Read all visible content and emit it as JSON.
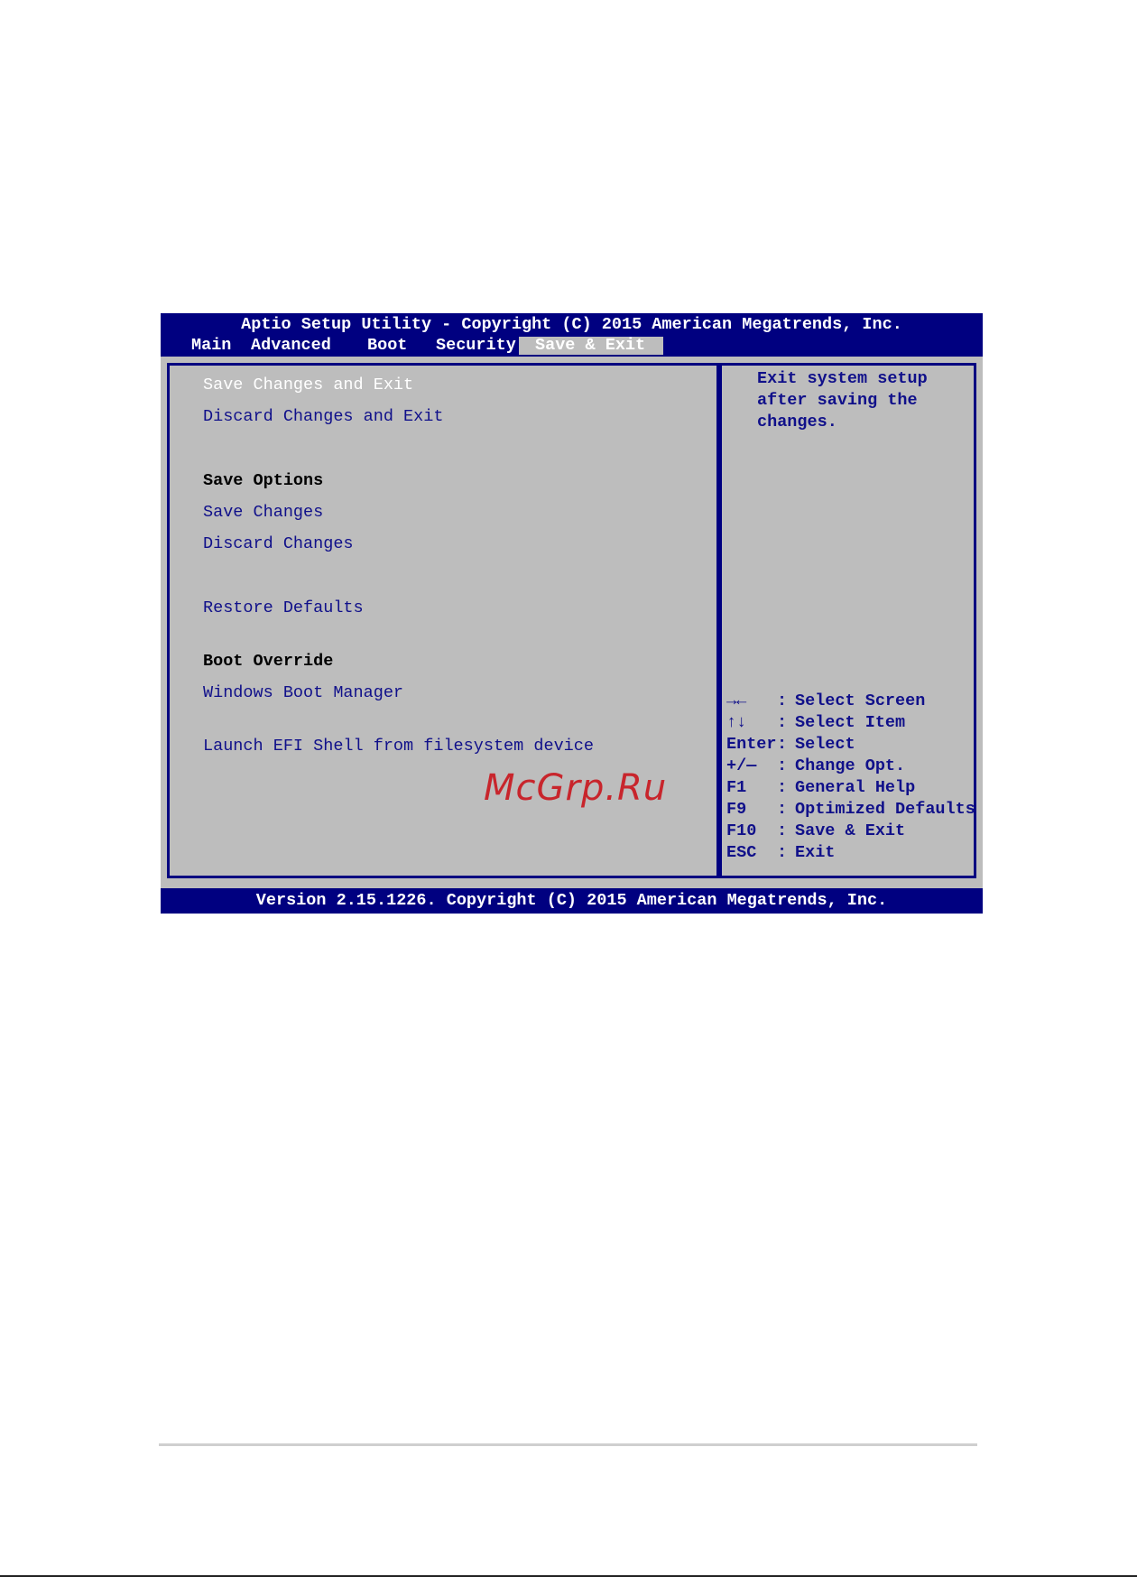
{
  "header": {
    "title": "Aptio Setup Utility - Copyright (C) 2015 American Megatrends, Inc."
  },
  "tabs": [
    {
      "label": "Main"
    },
    {
      "label": "Advanced"
    },
    {
      "label": "Boot"
    },
    {
      "label": "Security"
    },
    {
      "label": "Save & Exit",
      "active": true
    }
  ],
  "menu": {
    "save_changes_and_exit": "Save Changes and Exit",
    "discard_changes_and_exit": "Discard Changes and Exit",
    "save_options_heading": "Save Options",
    "save_changes": "Save Changes",
    "discard_changes": "Discard Changes",
    "restore_defaults": "Restore Defaults",
    "boot_override_heading": "Boot Override",
    "windows_boot_manager": "Windows Boot Manager",
    "launch_efi_shell": "Launch EFI Shell from filesystem device"
  },
  "help": {
    "line1": "Exit system setup",
    "line2": "after saving the",
    "line3": "changes."
  },
  "keys": [
    {
      "key": "→←",
      "sep": ":",
      "action": "Select Screen"
    },
    {
      "key": "↑↓",
      "sep": ":",
      "action": "Select Item"
    },
    {
      "key": "Enter",
      "sep": ":",
      "action": "Select"
    },
    {
      "key": "+/—",
      "sep": ":",
      "action": "Change Opt."
    },
    {
      "key": "F1",
      "sep": ":",
      "action": "General Help"
    },
    {
      "key": "F9",
      "sep": ":",
      "action": "Optimized Defaults"
    },
    {
      "key": "F10",
      "sep": ":",
      "action": "Save & Exit"
    },
    {
      "key": "ESC",
      "sep": ":",
      "action": "Exit"
    }
  ],
  "footer": {
    "version": "Version 2.15.1226. Copyright (C) 2015 American Megatrends, Inc."
  },
  "watermark": "McGrp.Ru",
  "colors": {
    "bios_blue": "#000080",
    "panel_gray": "#bdbdbd",
    "item_text": "#10108a",
    "watermark_red": "#c8252c"
  }
}
